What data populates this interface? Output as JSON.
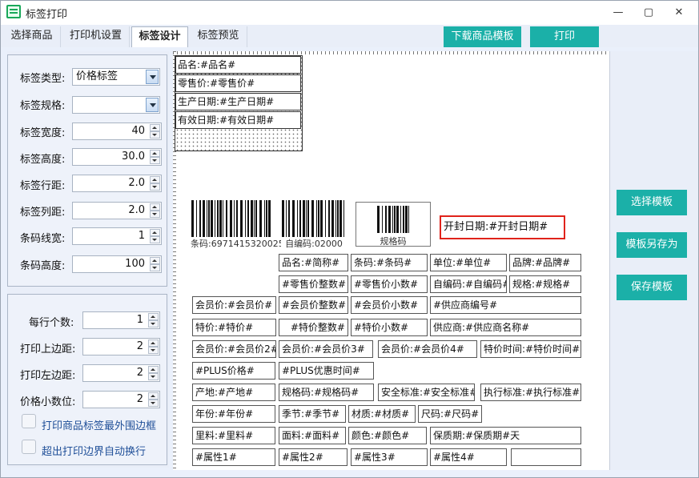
{
  "window": {
    "title": "标签打印",
    "minimize": "—",
    "maximize": "▢",
    "close": "✕"
  },
  "tabs": [
    "选择商品",
    "打印机设置",
    "标签设计",
    "标签预览"
  ],
  "top_buttons": {
    "download": "下载商品模板",
    "print": "打印"
  },
  "label_settings": {
    "type_label": "标签类型:",
    "type_value": "价格标签",
    "spec_label": "标签规格:",
    "spec_value": "",
    "width_label": "标签宽度:",
    "width_value": "40",
    "height_label": "标签高度:",
    "height_value": "30.0",
    "rowgap_label": "标签行距:",
    "rowgap_value": "2.0",
    "colgap_label": "标签列距:",
    "colgap_value": "2.0",
    "barwidth_label": "条码线宽:",
    "barwidth_value": "1",
    "barheight_label": "条码高度:",
    "barheight_value": "100"
  },
  "print_settings": {
    "per_row_label": "每行个数:",
    "per_row_value": "1",
    "top_margin_label": "打印上边距:",
    "top_margin_value": "2",
    "left_margin_label": "打印左边距:",
    "left_margin_value": "2",
    "decimals_label": "价格小数位:",
    "decimals_value": "2",
    "border_check": "打印商品标签最外围边框",
    "wrap_check": "超出打印边界自动换行"
  },
  "preview_fields": [
    "品名:#品名#",
    "零售价:#零售价#",
    "生产日期:#生产日期#",
    "有效日期:#有效日期#"
  ],
  "barcodes": {
    "code1": "条码:6971415320025",
    "code2": "自编码:02000",
    "code3": "规格码"
  },
  "selected_field": "开封日期:#开封日期#",
  "fields": {
    "f1": "品名:#简称#",
    "f2": "条码:#条码#",
    "f3": "单位:#单位#",
    "f4": "品牌:#品牌#",
    "f5": "#零售价整数#",
    "f6": "#零售价小数#",
    "f7": "自编码:#自编码#",
    "f8": "规格:#规格#",
    "f9": "会员价:#会员价#",
    "f10": "#会员价整数#",
    "f11": "#会员价小数#",
    "f12": "#供应商编号#",
    "f13": "特价:#特价#",
    "f14": "#特价整数#",
    "f15": "#特价小数#",
    "f16": "供应商:#供应商名称#",
    "f17": "会员价:#会员价2#",
    "f18": "会员价:#会员价3#",
    "f19": "会员价:#会员价4#",
    "f20": "特价时间:#特价时间#",
    "f21": "#PLUS价格#",
    "f22": "#PLUS优惠时间#",
    "f23": "产地:#产地#",
    "f24": "规格码:#规格码#",
    "f25": "安全标准:#安全标准#",
    "f26": "执行标准:#执行标准#",
    "f27": "年份:#年份#",
    "f28": "季节:#季节#",
    "f29": "材质:#材质#",
    "f30": "尺码:#尺码#",
    "f31": "里料:#里料#",
    "f32": "面料:#面料#",
    "f33": "颜色:#颜色#",
    "f34": "保质期:#保质期#天",
    "f35": "#属性1#",
    "f36": "#属性2#",
    "f37": "#属性3#",
    "f38": "#属性4#",
    "f39": ""
  },
  "right_buttons": {
    "select_template": "选择模板",
    "save_as": "模板另存为",
    "save": "保存模板"
  },
  "colors": {
    "accent": "#1bb0a8",
    "selection": "#e0231b"
  }
}
